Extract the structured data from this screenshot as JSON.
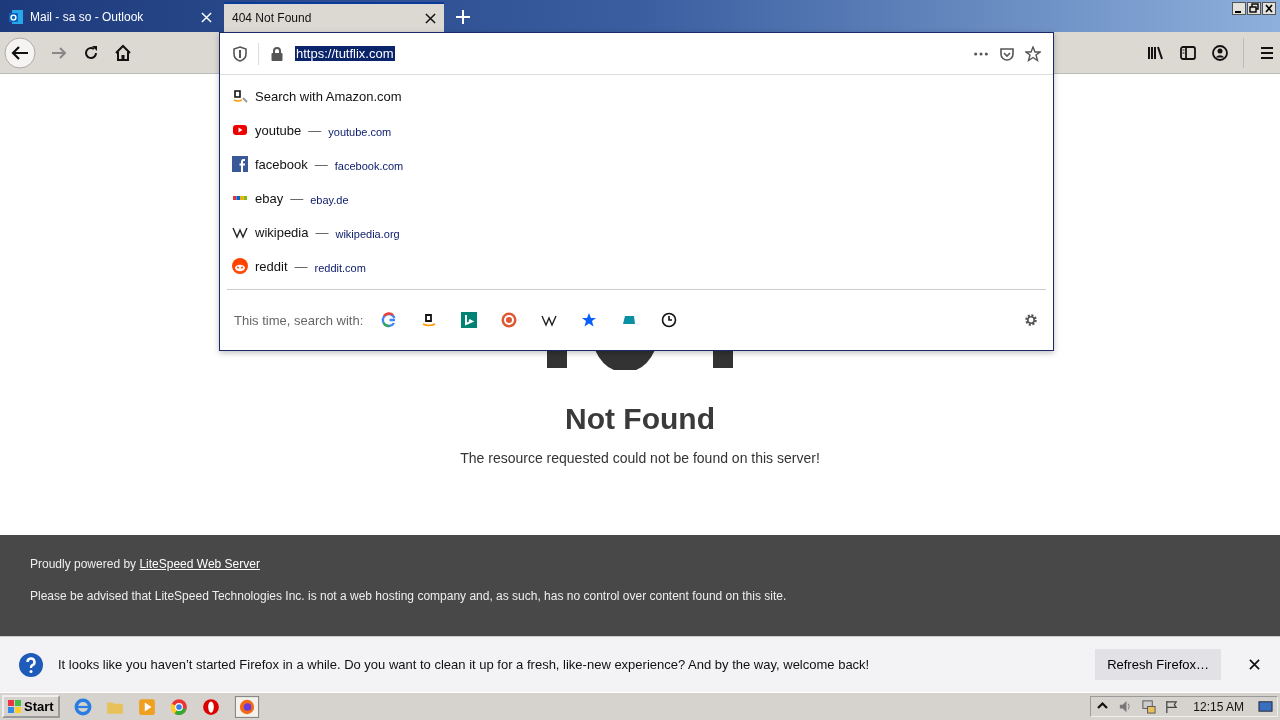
{
  "tabs": [
    {
      "title": "Mail - sa so - Outlook",
      "selected": false
    },
    {
      "title": "404 Not Found",
      "selected": true
    }
  ],
  "url_bar": {
    "value": "https://tutflix.com",
    "text_selected": true
  },
  "suggestions": [
    {
      "kind": "search",
      "title": "Search with Amazon.com"
    },
    {
      "kind": "site",
      "title": "youtube",
      "sep": "—",
      "url": "youtube.com"
    },
    {
      "kind": "site",
      "title": "facebook",
      "sep": "—",
      "url": "facebook.com"
    },
    {
      "kind": "site",
      "title": "ebay",
      "sep": "—",
      "url": "ebay.de"
    },
    {
      "kind": "site",
      "title": "wikipedia",
      "sep": "—",
      "url": "wikipedia.org"
    },
    {
      "kind": "site",
      "title": "reddit",
      "sep": "—",
      "url": "reddit.com"
    }
  ],
  "search_with_label": "This time, search with:",
  "page": {
    "heading": "Not Found",
    "message": "The resource requested could not be found on this server!"
  },
  "footer": {
    "powered": "Proudly powered by",
    "link": "LiteSpeed Web Server",
    "notice": "Please be advised that LiteSpeed Technologies Inc. is not a web hosting company and, as such, has no control over content found on this site."
  },
  "notification": {
    "message": "It looks like you haven’t started Firefox in a while. Do you want to clean it up for a fresh, like-new experience? And by the way, welcome back!",
    "button": "Refresh Firefox…"
  },
  "taskbar": {
    "start": "Start",
    "clock": "12:15 AM"
  }
}
